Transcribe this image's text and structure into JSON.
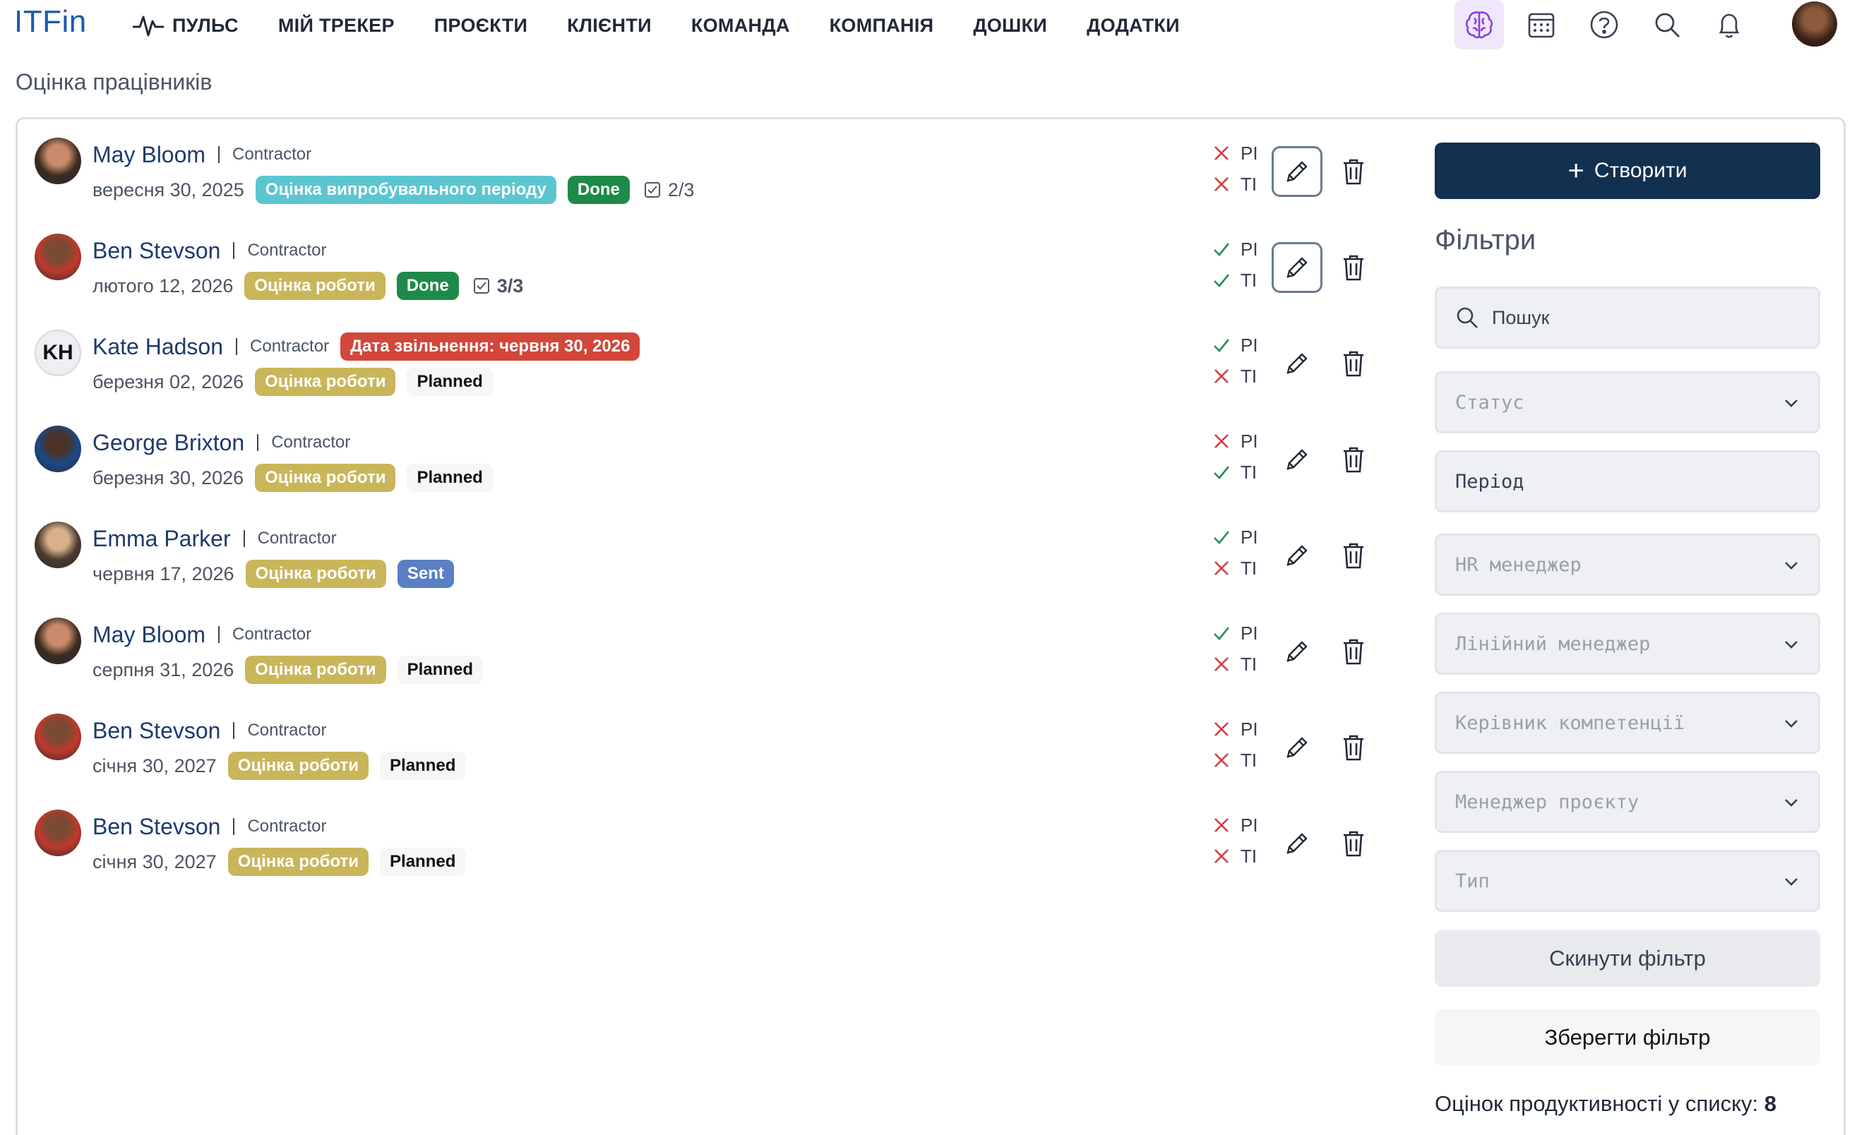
{
  "app": {
    "logo": "ITFin"
  },
  "nav": [
    {
      "label": "ПУЛЬС",
      "icon": "pulse-icon"
    },
    {
      "label": "МІЙ ТРЕКЕР"
    },
    {
      "label": "ПРОЄКТИ"
    },
    {
      "label": "КЛІЄНТИ"
    },
    {
      "label": "КОМАНДА"
    },
    {
      "label": "КОМПАНІЯ"
    },
    {
      "label": "ДОШКИ"
    },
    {
      "label": "ДОДАТКИ"
    }
  ],
  "top_icons": [
    "brain-icon",
    "calendar-icon",
    "help-icon",
    "search-icon",
    "bell-icon",
    "avatar"
  ],
  "page": {
    "title": "Оцінка працівників"
  },
  "rows": [
    {
      "name": "May Bloom",
      "role": "Contractor",
      "date": "вересня 30, 2025",
      "type": "Оцінка випробувального періоду",
      "type_color": "cyan",
      "status": "Done",
      "status_color": "green",
      "progress": "2/3",
      "pi": false,
      "ti": false,
      "dismissal": ""
    },
    {
      "name": "Ben Stevson",
      "role": "Contractor",
      "date": "лютого 12, 2026",
      "type": "Оцінка роботи",
      "type_color": "yellow",
      "status": "Done",
      "status_color": "green",
      "progress": "3/3",
      "pi": true,
      "ti": true,
      "dismissal": ""
    },
    {
      "name": "Kate Hadson",
      "role": "Contractor",
      "initials": "KH",
      "date": "березня 02, 2026",
      "type": "Оцінка роботи",
      "type_color": "yellow",
      "status": "Planned",
      "status_color": "plain",
      "progress": "",
      "pi": true,
      "ti": false,
      "dismissal": "Дата звільнення: червня 30, 2026"
    },
    {
      "name": "George Brixton",
      "role": "Contractor",
      "date": "березня 30, 2026",
      "type": "Оцінка роботи",
      "type_color": "yellow",
      "status": "Planned",
      "status_color": "plain",
      "progress": "",
      "pi": false,
      "ti": true,
      "dismissal": ""
    },
    {
      "name": "Emma Parker",
      "role": "Contractor",
      "date": "червня 17, 2026",
      "type": "Оцінка роботи",
      "type_color": "yellow",
      "status": "Sent",
      "status_color": "blue",
      "progress": "",
      "pi": true,
      "ti": false,
      "dismissal": ""
    },
    {
      "name": "May Bloom",
      "role": "Contractor",
      "date": "серпня 31, 2026",
      "type": "Оцінка роботи",
      "type_color": "yellow",
      "status": "Planned",
      "status_color": "plain",
      "progress": "",
      "pi": true,
      "ti": false,
      "dismissal": ""
    },
    {
      "name": "Ben Stevson",
      "role": "Contractor",
      "date": "січня 30, 2027",
      "type": "Оцінка роботи",
      "type_color": "yellow",
      "status": "Planned",
      "status_color": "plain",
      "progress": "",
      "pi": false,
      "ti": false,
      "dismissal": ""
    },
    {
      "name": "Ben Stevson",
      "role": "Contractor",
      "date": "січня 30, 2027",
      "type": "Оцінка роботи",
      "type_color": "yellow",
      "status": "Planned",
      "status_color": "plain",
      "progress": "",
      "pi": false,
      "ti": false,
      "dismissal": ""
    }
  ],
  "labels": {
    "pi": "PI",
    "ti": "TI"
  },
  "sidebar": {
    "create_label": "Створити",
    "filters_title": "Фільтри",
    "search_placeholder": "Пошук",
    "status_placeholder": "Статус",
    "period_placeholder": "Період",
    "hr_placeholder": "HR менеджер",
    "line_manager_placeholder": "Лінійний менеджер",
    "competence_placeholder": "Керівник компетенції",
    "project_manager_placeholder": "Менеджер проєкту",
    "type_placeholder": "Тип",
    "reset_label": "Скинути фільтр",
    "save_label": "Зберегти фільтр",
    "count_label": "Оцінок продуктивності у списку:",
    "count_value": "8"
  },
  "colors": {
    "accent": "#12304f",
    "brand": "#1e5aa8",
    "check": "#2e8b57",
    "cross": "#d23b3b"
  }
}
